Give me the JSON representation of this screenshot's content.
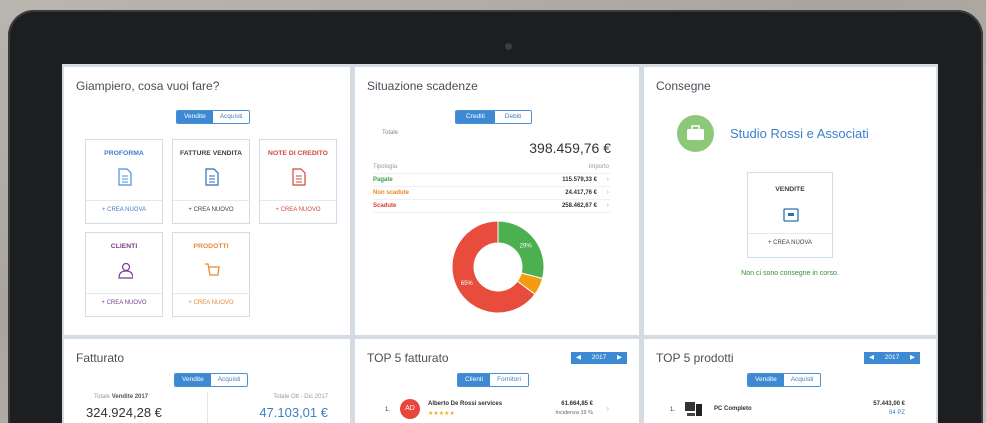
{
  "card1": {
    "title": "Giampiero, cosa vuoi fare?",
    "toggle": [
      "Vendite",
      "Acquisti"
    ],
    "tiles": [
      {
        "title": "PROFORMA",
        "action": "+ CREA NUOVA",
        "icon": "document-icon"
      },
      {
        "title": "FATTURE VENDITA",
        "action": "+ CREA NUOVO",
        "icon": "invoice-icon"
      },
      {
        "title": "NOTE DI CREDITO",
        "action": "+ CREA NUOVO",
        "icon": "credit-note-icon"
      },
      {
        "title": "CLIENTI",
        "action": "+ CREA NUOVO",
        "icon": "users-icon"
      },
      {
        "title": "PRODOTTI",
        "action": "+ CREA NUOVO",
        "icon": "cart-icon"
      }
    ]
  },
  "card2": {
    "title": "Situazione scadenze",
    "toggle": [
      "Crediti",
      "Debiti"
    ],
    "total_label": "Totale",
    "total_value": "398.459,76 €",
    "col_type": "Tipologia",
    "col_amount": "Importo",
    "rows": [
      {
        "label": "Pagate",
        "value": "115.579,33 €"
      },
      {
        "label": "Non scadute",
        "value": "24.417,76 €"
      },
      {
        "label": "Scadute",
        "value": "258.462,67 €"
      }
    ],
    "colors": {
      "pagate": "#4caf50",
      "non_scadute": "#f39c12",
      "scadute": "#e74c3c"
    }
  },
  "chart_data": {
    "type": "pie",
    "categories": [
      "Pagate",
      "Non scadute",
      "Scadute"
    ],
    "values": [
      115579.33,
      24417.76,
      258462.67
    ],
    "data_labels": [
      "29%",
      "",
      "65%"
    ]
  },
  "card3": {
    "title": "Consegne",
    "company": "Studio Rossi e Associati",
    "tile_title": "VENDITE",
    "tile_action": "+ CREA NUOVA",
    "empty_msg": "Non ci sono consegne in corso."
  },
  "card4": {
    "title": "Fatturato",
    "toggle": [
      "Vendite",
      "Acquisti"
    ],
    "left_label_prefix": "Totale",
    "left_label_strong": "Vendite 2017",
    "left_value": "324.924,28 €",
    "right_label": "Totale Ott - Dic 2017",
    "right_value": "47.103,01 €"
  },
  "card5": {
    "title": "TOP 5 fatturato",
    "year": "2017",
    "toggle": [
      "Clienti",
      "Fornitori"
    ],
    "item": {
      "rank": "1.",
      "initials": "AD",
      "name": "Alberto De Rossi services",
      "stars": "★★★★★",
      "value": "61.664,85 €",
      "incidence": "Incidenza 19 %"
    }
  },
  "card6": {
    "title": "TOP 5 prodotti",
    "year": "2017",
    "toggle": [
      "Vendite",
      "Acquisti"
    ],
    "item": {
      "rank": "1.",
      "name": "PC Completo",
      "value": "57.443,00 €",
      "qty": "84 PZ"
    }
  }
}
